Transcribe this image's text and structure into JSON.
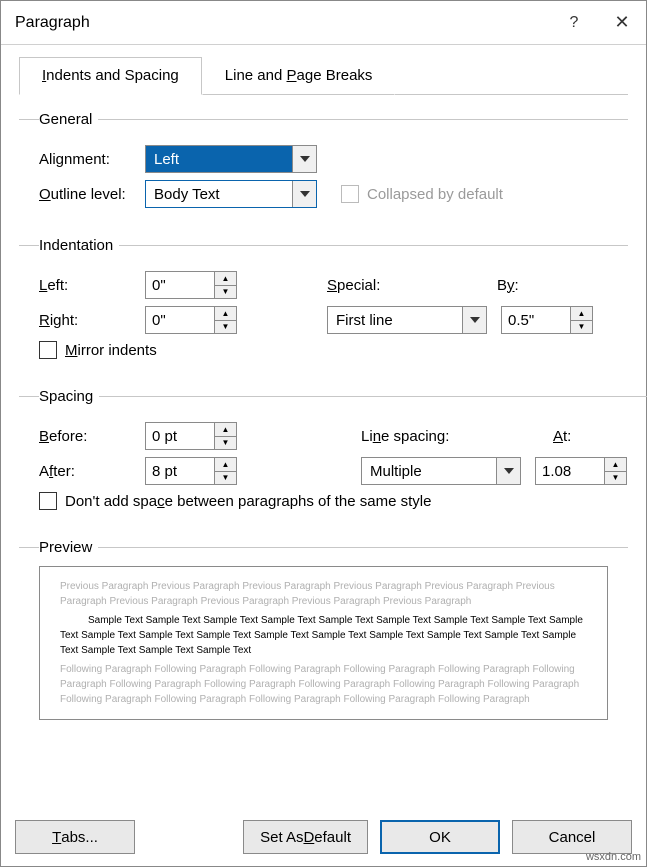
{
  "title": "Paragraph",
  "help_glyph": "?",
  "close_glyph": "✕",
  "tabs": {
    "indents": "Indents and Spacing",
    "breaks": "Line and Page Breaks"
  },
  "general": {
    "legend": "General",
    "alignment_label": "Alignment:",
    "alignment_value": "Left",
    "outline_label": "Outline level:",
    "outline_value": "Body Text",
    "collapsed_label": "Collapsed by default"
  },
  "indentation": {
    "legend": "Indentation",
    "left_label": "Left:",
    "left_value": "0\"",
    "right_label": "Right:",
    "right_value": "0\"",
    "special_label": "Special:",
    "special_value": "First line",
    "by_label": "By:",
    "by_value": "0.5\"",
    "mirror_label": "Mirror indents"
  },
  "spacing": {
    "legend": "Spacing",
    "before_label": "Before:",
    "before_value": "0 pt",
    "after_label": "After:",
    "after_value": "8 pt",
    "line_label": "Line spacing:",
    "line_value": "Multiple",
    "at_label": "At:",
    "at_value": "1.08",
    "dont_add_label": "Don't add space between paragraphs of the same style"
  },
  "preview": {
    "legend": "Preview",
    "prev_text": "Previous Paragraph Previous Paragraph Previous Paragraph Previous Paragraph Previous Paragraph Previous Paragraph Previous Paragraph Previous Paragraph Previous Paragraph Previous Paragraph",
    "cur_text": "Sample Text Sample Text Sample Text Sample Text Sample Text Sample Text Sample Text Sample Text Sample Text Sample Text Sample Text Sample Text Sample Text Sample Text Sample Text Sample Text Sample Text Sample Text Sample Text Sample Text Sample Text",
    "next_text": "Following Paragraph Following Paragraph Following Paragraph Following Paragraph Following Paragraph Following Paragraph Following Paragraph Following Paragraph Following Paragraph Following Paragraph Following Paragraph Following Paragraph Following Paragraph Following Paragraph Following Paragraph Following Paragraph"
  },
  "buttons": {
    "tabs": "Tabs...",
    "default": "Set As Default",
    "ok": "OK",
    "cancel": "Cancel"
  },
  "watermark": "wsxdn.com"
}
